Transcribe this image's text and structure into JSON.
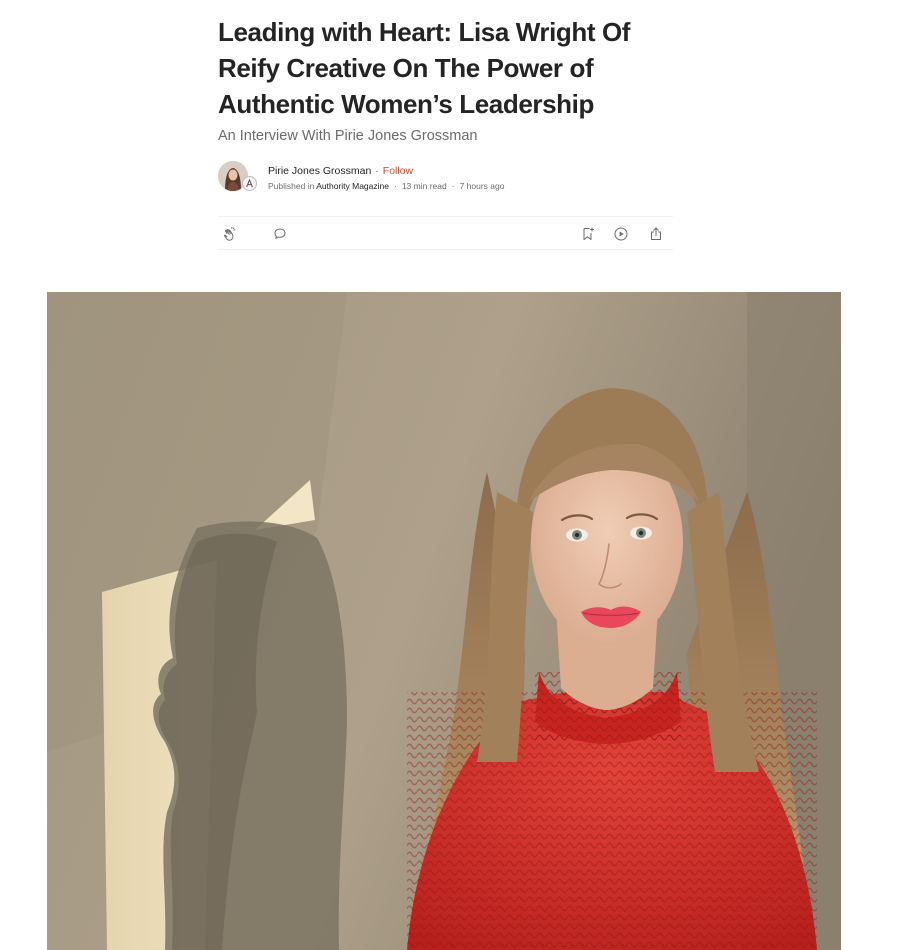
{
  "article": {
    "title": "Leading with Heart: Lisa Wright Of Reify Creative On The Power of Authentic Women’s Leadership",
    "subtitle": "An Interview With Pirie Jones Grossman"
  },
  "byline": {
    "author": "Pirie Jones Grossman",
    "separator": "·",
    "follow_label": "Follow",
    "published_prefix": "Published in",
    "publication": "Authority Magazine",
    "read_time": "13 min read",
    "meta_separator": "·",
    "posted": "7 hours ago"
  },
  "actions": {
    "icons": [
      "clap-icon",
      "comment-icon",
      "bookmark-add-icon",
      "play-icon",
      "share-icon"
    ],
    "icon_color": "#6b6b6b"
  },
  "hero_image": {
    "subject": "woman-in-red-sweater-portrait",
    "colors": {
      "wall": "#a49780",
      "sweater": "#d8322c",
      "hair": "#9a7a58"
    }
  },
  "colors": {
    "title": "#242424",
    "muted": "#6b6b6b",
    "follow": "#c94a2e",
    "divider": "#f0f0f0"
  }
}
